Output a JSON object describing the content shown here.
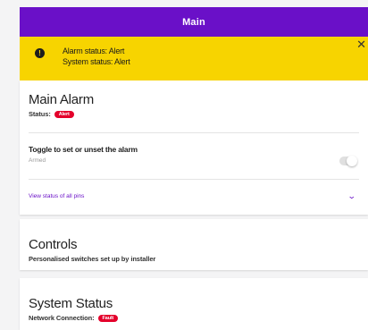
{
  "header": {
    "title": "Main"
  },
  "alert": {
    "icon": "info-icon",
    "icon_glyph": "!",
    "line1": "Alarm status: Alert",
    "line2": "System status: Alert",
    "close_glyph": "✕",
    "color": "#f7d400"
  },
  "main_alarm": {
    "title": "Main Alarm",
    "status_label": "Status:",
    "status_badge": "Alert",
    "toggle_label": "Toggle to set or unset the alarm",
    "toggle_state": "Armed",
    "toggle_on": false,
    "pins_link": "View status of all pins",
    "chevron_glyph": "⌄"
  },
  "controls": {
    "title": "Controls",
    "subtitle": "Personalised switches set up by installer"
  },
  "system_status": {
    "title": "System Status",
    "connection_label": "Network Connection:",
    "connection_badge": "Fault"
  },
  "colors": {
    "brand": "#6a10c8",
    "alert_badge": "#e4002b"
  }
}
